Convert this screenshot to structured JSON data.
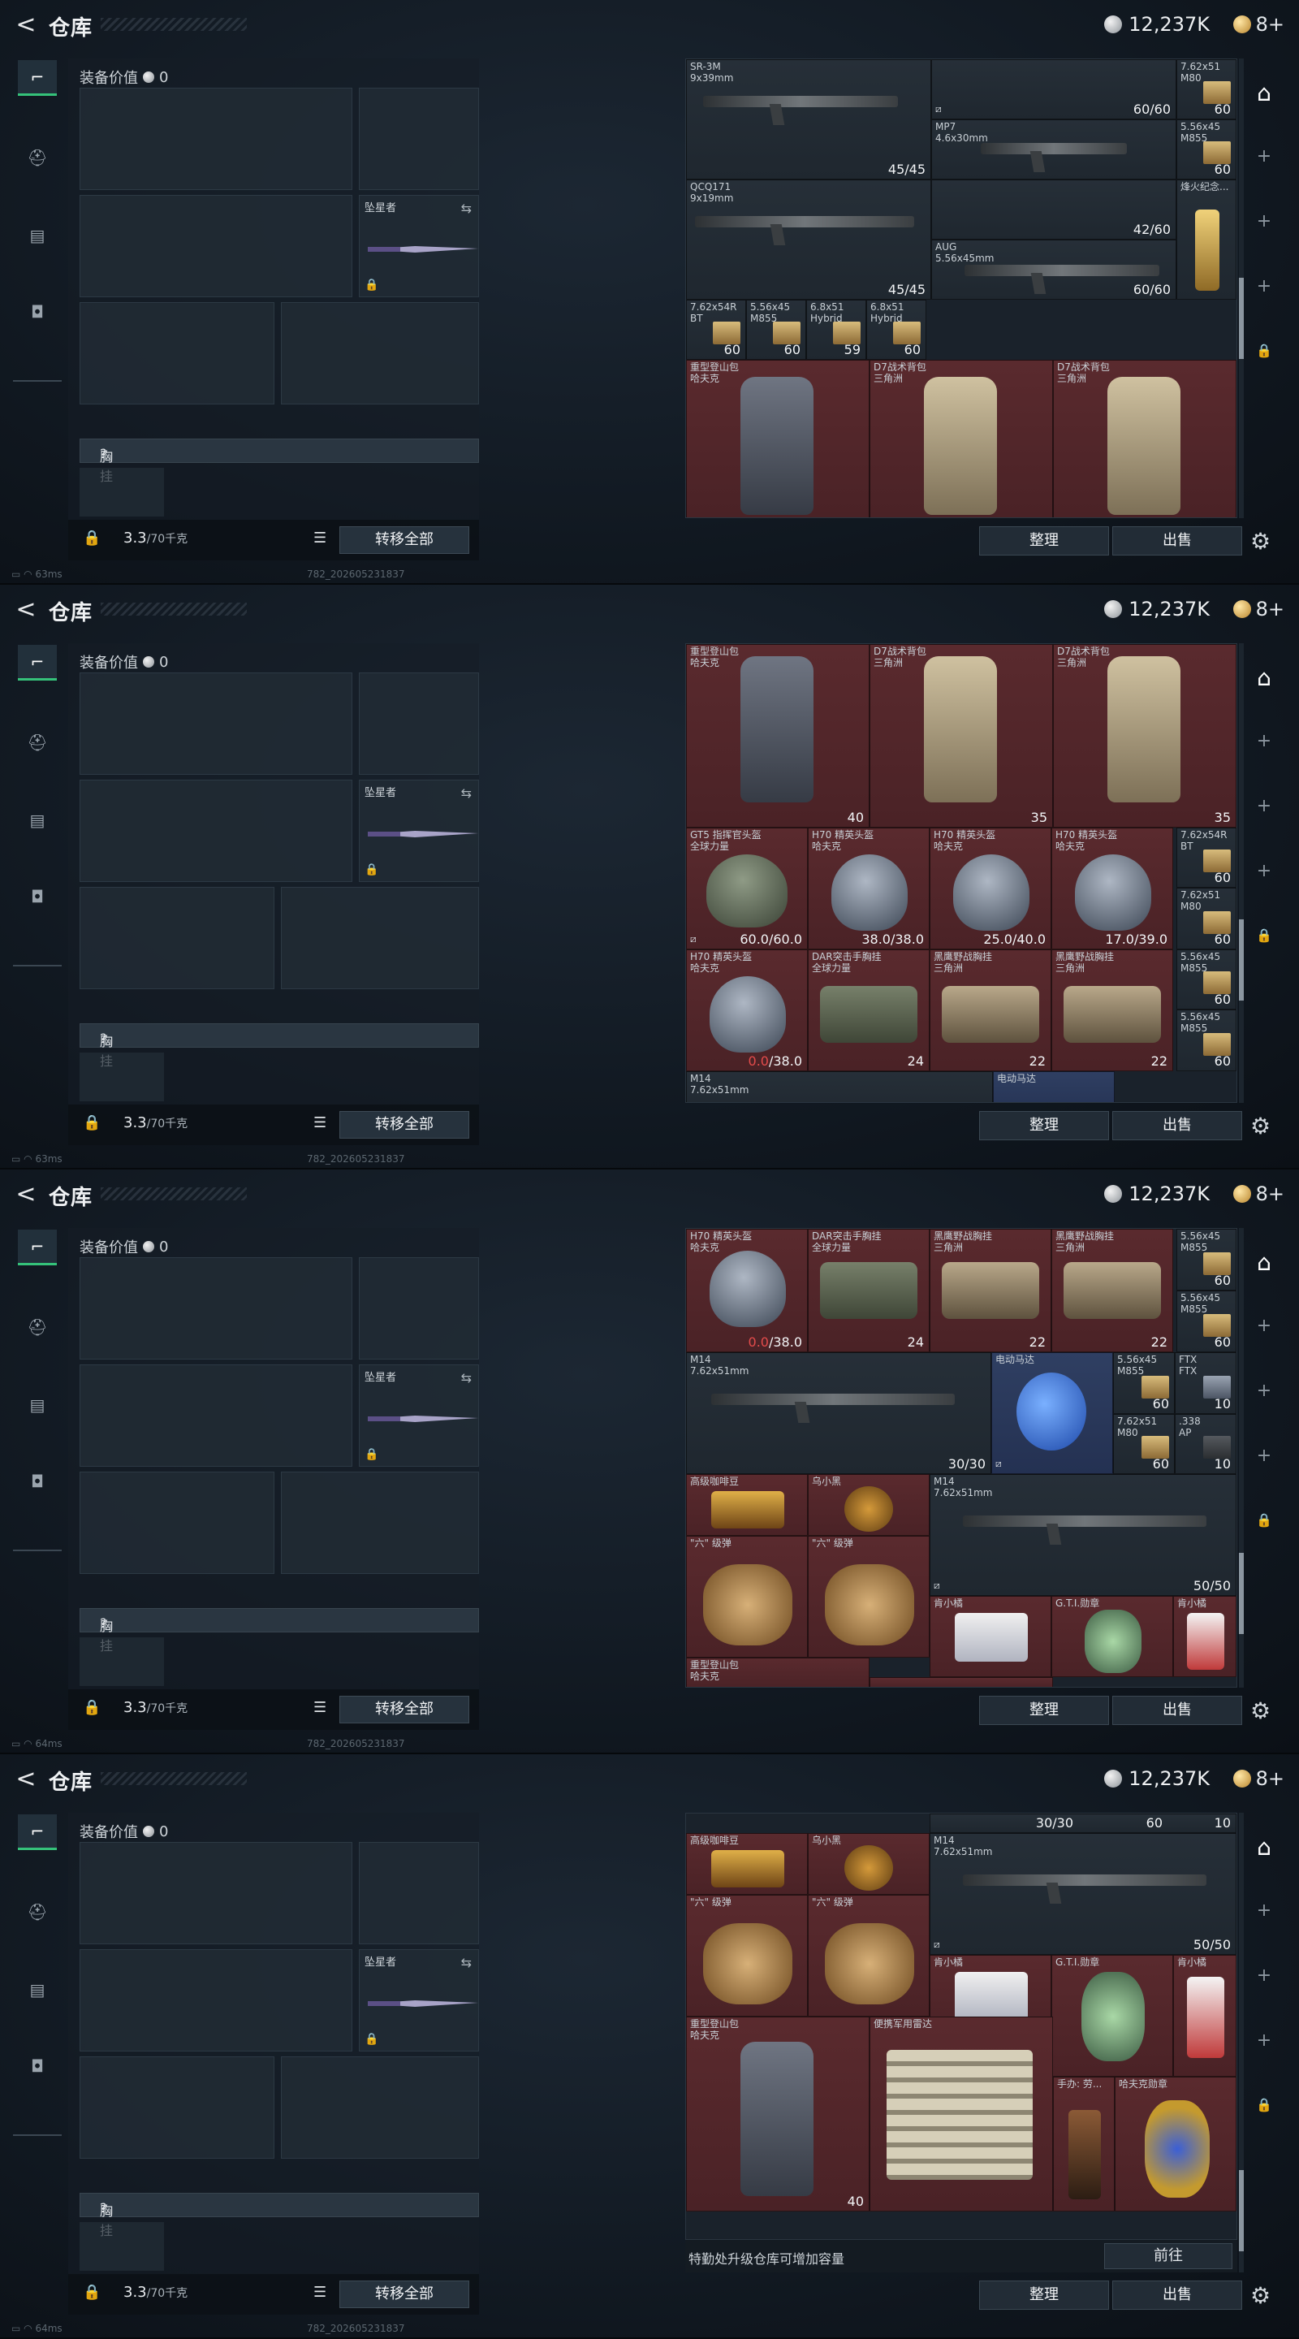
{
  "header": {
    "back": "<",
    "title": "仓库",
    "currency": "12,237K",
    "premium": "8+"
  },
  "loadout": {
    "equip_value_label": "装备价值",
    "equip_value": "0",
    "melee_label": "坠星者",
    "rig_label": "胸挂",
    "rig_help": "?",
    "weight_value": "3.3",
    "weight_max": "/70千克",
    "transfer_all": "转移全部"
  },
  "footer": {
    "ping_1": "63ms",
    "ping_2": "63ms",
    "ping_3": "64ms",
    "ping_4": "64ms",
    "build": "782_202605231837"
  },
  "storage": {
    "sort": "整理",
    "sell": "出售",
    "upgrade_hint": "特勤处升级仓库可增加容量",
    "goto": "前往"
  },
  "items": {
    "sr3m": {
      "name": "SR-3M\n9x39mm",
      "count": "45/45"
    },
    "mp7": {
      "name": "MP7\n4.6x30mm",
      "count": "60/60"
    },
    "qcq171": {
      "name": "QCQ171\n9x19mm",
      "count": "45/45"
    },
    "mp7b": {
      "count": "42/60"
    },
    "aug": {
      "name": "AUG\n5.56x45mm",
      "count": "60/60"
    },
    "ammo762x51": {
      "name": "7.62x51\nM80",
      "count": "60"
    },
    "ammo556m855": {
      "name": "5.56x45\nM855",
      "count": "60"
    },
    "trophy": {
      "name": "烽火纪念..."
    },
    "a1": {
      "name": "7.62x54R\nBT",
      "count": "60"
    },
    "a2": {
      "name": "5.56x45\nM855",
      "count": "60"
    },
    "a3": {
      "name": "6.8x51\nHybrid",
      "count": "59"
    },
    "a4": {
      "name": "6.8x51\nHybrid",
      "count": "60"
    },
    "pack1": {
      "name": "重型登山包\n哈夫克",
      "count": "40"
    },
    "pack2": {
      "name": "D7战术背包\n三角洲",
      "count": "35"
    },
    "pack3": {
      "name": "D7战术背包\n三角洲",
      "count": "35"
    },
    "gt5": {
      "name": "GT5 指挥官头盔\n全球力量",
      "count": "60.0/60.0"
    },
    "h70a": {
      "name": "H70 精英头盔\n哈夫克",
      "count": "38.0/38.0"
    },
    "h70b": {
      "name": "H70 精英头盔\n哈夫克",
      "count": "25.0/40.0"
    },
    "h70c": {
      "name": "H70 精英头盔\n哈夫克",
      "count": "17.0/39.0"
    },
    "h70d": {
      "name": "H70 精英头盔\n哈夫克",
      "count_red": "0.0",
      "count": "/38.0"
    },
    "dar": {
      "name": "DAR突击手胸挂\n全球力量",
      "count": "24"
    },
    "hawk1": {
      "name": "黑鹰野战胸挂\n三角洲",
      "count": "22"
    },
    "hawk2": {
      "name": "黑鹰野战胸挂\n三角洲",
      "count": "22"
    },
    "b1": {
      "name": "7.62x54R\nBT",
      "count": "60"
    },
    "b2": {
      "name": "7.62x51\nM80",
      "count": "60"
    },
    "b3": {
      "name": "5.56x45\nM855",
      "count": "60"
    },
    "b4": {
      "name": "5.56x45\nM855",
      "count": "60"
    },
    "m14a": {
      "name": "M14\n7.62x51mm",
      "count": "30/30"
    },
    "motor": {
      "name": "电动马达"
    },
    "c1": {
      "name": "5.56x45\nM855",
      "count": "60"
    },
    "c2": {
      "name": "FTX\nFTX",
      "count": "10"
    },
    "c3": {
      "name": "7.62x51\nM80",
      "count": "60"
    },
    "c4": {
      "name": ".338\nAP",
      "count": "10"
    },
    "coffee": {
      "name": "高级咖啡豆"
    },
    "bird": {
      "name": "乌小黑"
    },
    "m14b": {
      "name": "M14\n7.62x51mm",
      "count": "50/50"
    },
    "ammo6a": {
      "name": "\"六\" 级弹"
    },
    "ammo6b": {
      "name": "\"六\" 级弹"
    },
    "gear_blue": {
      "name": "肯小橘"
    },
    "gti": {
      "name": "G.T.I.勋章"
    },
    "gear_white": {
      "name": "肯小橘"
    },
    "radar": {
      "name": "便携军用雷达"
    },
    "figure": {
      "name": "手办: 劳..."
    },
    "medal": {
      "name": "哈夫克勋章"
    },
    "pack4": {
      "name": "重型登山包\n哈夫克",
      "count": "40"
    }
  }
}
